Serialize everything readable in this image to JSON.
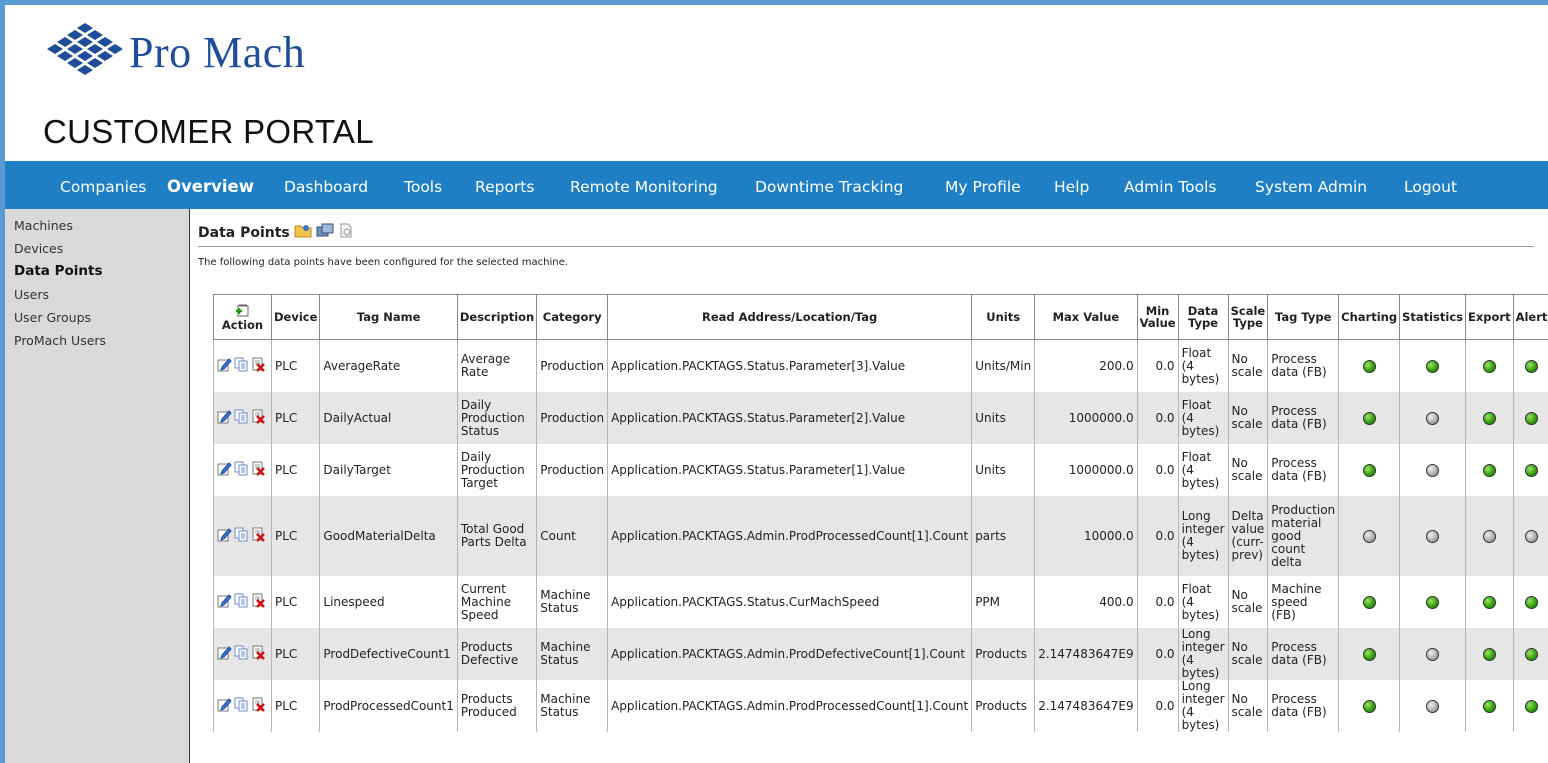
{
  "header": {
    "logo_text": "Pro Mach",
    "portal_title": "CUSTOMER PORTAL"
  },
  "nav": {
    "items": [
      {
        "label": "Companies"
      },
      {
        "label": "Overview",
        "active": true
      },
      {
        "label": "Dashboard"
      },
      {
        "label": "Tools"
      },
      {
        "label": "Reports"
      },
      {
        "label": "Remote Monitoring"
      },
      {
        "label": "Downtime Tracking"
      },
      {
        "label": "My Profile"
      },
      {
        "label": "Help"
      },
      {
        "label": "Admin Tools"
      },
      {
        "label": "System Admin"
      },
      {
        "label": "Logout"
      }
    ]
  },
  "sidebar": {
    "items": [
      {
        "label": "Machines"
      },
      {
        "label": "Devices"
      },
      {
        "label": "Data Points",
        "active": true
      },
      {
        "label": "Users"
      },
      {
        "label": "User Groups"
      },
      {
        "label": "ProMach Users"
      }
    ]
  },
  "main": {
    "title": "Data Points",
    "title_icons": [
      "folder-icon",
      "export-icon",
      "settings-doc-icon"
    ],
    "subtitle": "The following data points have been configured for the selected machine."
  },
  "table": {
    "headers": {
      "action": "Action",
      "device": "Device",
      "tag_name": "Tag Name",
      "description": "Description",
      "category": "Category",
      "address": "Read Address/Location/Tag",
      "units": "Units",
      "max_value": "Max Value",
      "min_value_1": "Min",
      "min_value_2": "Value",
      "data_type_1": "Data",
      "data_type_2": "Type",
      "scale_type_1": "Scale",
      "scale_type_2": "Type",
      "tag_type": "Tag Type",
      "charting": "Charting",
      "statistics": "Statistics",
      "export": "Export",
      "alert": "Alert"
    },
    "row_icons": [
      "edit-icon",
      "copy-icon",
      "delete-icon"
    ],
    "colors": {
      "green": "#34a10c",
      "gray": "#a9a9a9"
    },
    "rows": [
      {
        "device": "PLC",
        "tag": "AverageRate",
        "description": "Average Rate",
        "category": "Production",
        "address": "Application.PACKTAGS.Status.Parameter[3].Value",
        "units": "Units/Min",
        "max": "200.0",
        "min": "0.0",
        "data_type": "Float (4 bytes)",
        "scale_type": "No scale",
        "tag_type": "Process data (FB)",
        "charting": "green",
        "statistics": "green",
        "export": "green",
        "alert": "green"
      },
      {
        "device": "PLC",
        "tag": "DailyActual",
        "description": "Daily Production Status",
        "category": "Production",
        "address": "Application.PACKTAGS.Status.Parameter[2].Value",
        "units": "Units",
        "max": "1000000.0",
        "min": "0.0",
        "data_type": "Float (4 bytes)",
        "scale_type": "No scale",
        "tag_type": "Process data (FB)",
        "charting": "green",
        "statistics": "gray",
        "export": "green",
        "alert": "green"
      },
      {
        "device": "PLC",
        "tag": "DailyTarget",
        "description": "Daily Production Target",
        "category": "Production",
        "address": "Application.PACKTAGS.Status.Parameter[1].Value",
        "units": "Units",
        "max": "1000000.0",
        "min": "0.0",
        "data_type": "Float (4 bytes)",
        "scale_type": "No scale",
        "tag_type": "Process data (FB)",
        "charting": "green",
        "statistics": "gray",
        "export": "green",
        "alert": "green"
      },
      {
        "device": "PLC",
        "tag": "GoodMaterialDelta",
        "description": "Total Good Parts Delta",
        "category": "Count",
        "address": "Application.PACKTAGS.Admin.ProdProcessedCount[1].Count",
        "units": "parts",
        "max": "10000.0",
        "min": "0.0",
        "data_type": "Long integer (4 bytes)",
        "scale_type": "Delta value (curr-prev)",
        "tag_type": "Production material good count delta",
        "charting": "gray",
        "statistics": "gray",
        "export": "gray",
        "alert": "gray"
      },
      {
        "device": "PLC",
        "tag": "Linespeed",
        "description": "Current Machine Speed",
        "category": "Machine Status",
        "address": "Application.PACKTAGS.Status.CurMachSpeed",
        "units": "PPM",
        "max": "400.0",
        "min": "0.0",
        "data_type": "Float (4 bytes)",
        "scale_type": "No scale",
        "tag_type": "Machine speed (FB)",
        "charting": "green",
        "statistics": "green",
        "export": "green",
        "alert": "green"
      },
      {
        "device": "PLC",
        "tag": "ProdDefectiveCount1",
        "description": "Products Defective",
        "category": "Machine Status",
        "address": "Application.PACKTAGS.Admin.ProdDefectiveCount[1].Count",
        "units": "Products",
        "max": "2.147483647E9",
        "min": "0.0",
        "data_type": "Long integer (4 bytes)",
        "scale_type": "No scale",
        "tag_type": "Process data (FB)",
        "charting": "green",
        "statistics": "gray",
        "export": "green",
        "alert": "green"
      },
      {
        "device": "PLC",
        "tag": "ProdProcessedCount1",
        "description": "Products Produced",
        "category": "Machine Status",
        "address": "Application.PACKTAGS.Admin.ProdProcessedCount[1].Count",
        "units": "Products",
        "max": "2.147483647E9",
        "min": "0.0",
        "data_type": "Long integer (4 bytes)",
        "scale_type": "No scale",
        "tag_type": "Process data (FB)",
        "charting": "green",
        "statistics": "gray",
        "export": "green",
        "alert": "green"
      }
    ]
  }
}
